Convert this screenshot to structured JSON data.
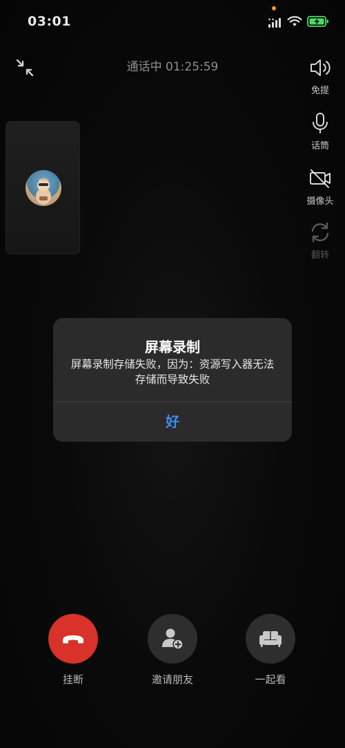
{
  "status_bar": {
    "time": "03:01",
    "icons": [
      "signal-icon",
      "wifi-icon",
      "battery-charging-icon"
    ],
    "notification_dot_color": "#f29a1b",
    "battery_color": "#4cd964"
  },
  "call": {
    "status_text": "通话中 01:25:59"
  },
  "side_controls": [
    {
      "icon": "speaker-icon",
      "label": "免提"
    },
    {
      "icon": "microphone-icon",
      "label": "话筒"
    },
    {
      "icon": "camera-off-icon",
      "label": "摄像头"
    },
    {
      "icon": "flip-camera-icon",
      "label": "翻转"
    }
  ],
  "dialog": {
    "title": "屏幕录制",
    "message": "屏幕录制存储失败，因为：资源写入器无法存储而导致失败",
    "ok_label": "好",
    "ok_color": "#3b8cf5"
  },
  "actions": [
    {
      "icon": "hang-up-icon",
      "label": "挂断",
      "color": "#d8322a"
    },
    {
      "icon": "invite-friend-icon",
      "label": "邀请朋友"
    },
    {
      "icon": "sofa-icon",
      "label": "一起看"
    }
  ]
}
